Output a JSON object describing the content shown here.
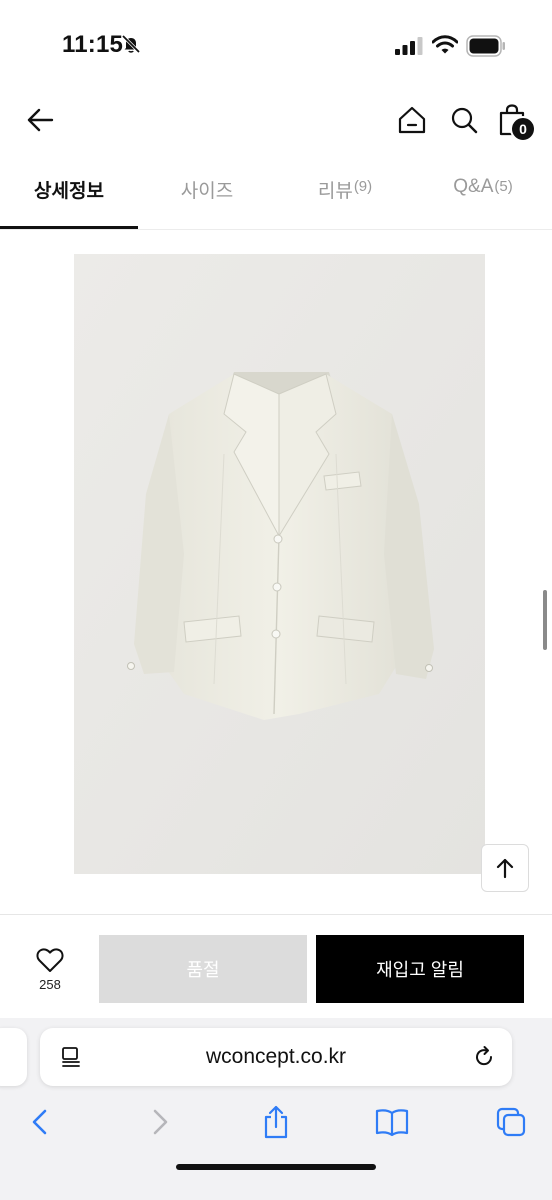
{
  "status_bar": {
    "time": "11:15",
    "icons": [
      "bell-slash-icon",
      "cellular-signal-icon",
      "wifi-icon",
      "battery-icon"
    ]
  },
  "header": {
    "back_icon": "arrow-left-icon",
    "home_icon": "home-icon",
    "search_icon": "search-icon",
    "bag_icon": "shopping-bag-icon",
    "bag_count": "0"
  },
  "tabs": [
    {
      "label": "상세정보",
      "count": "",
      "active": true
    },
    {
      "label": "사이즈",
      "count": "",
      "active": false
    },
    {
      "label": "리뷰",
      "count": "(9)",
      "active": false
    },
    {
      "label": "Q&A",
      "count": "(5)",
      "active": false
    }
  ],
  "product": {
    "image": "cream-linen-blazer-photo"
  },
  "purchase_bar": {
    "like_icon": "heart-icon",
    "like_count": "258",
    "soldout_label": "품절",
    "restock_label": "재입고 알림"
  },
  "browser": {
    "url": "wconcept.co.kr",
    "toolbar_icons": [
      "chevron-left-icon",
      "chevron-right-icon",
      "share-icon",
      "bookmarks-icon",
      "tabs-icon"
    ]
  },
  "colors": {
    "accent": "#000000",
    "soldout_bg": "#dcdcdc",
    "tab_inactive": "#9a9a9a",
    "browser_blue": "#2f7cf6"
  }
}
